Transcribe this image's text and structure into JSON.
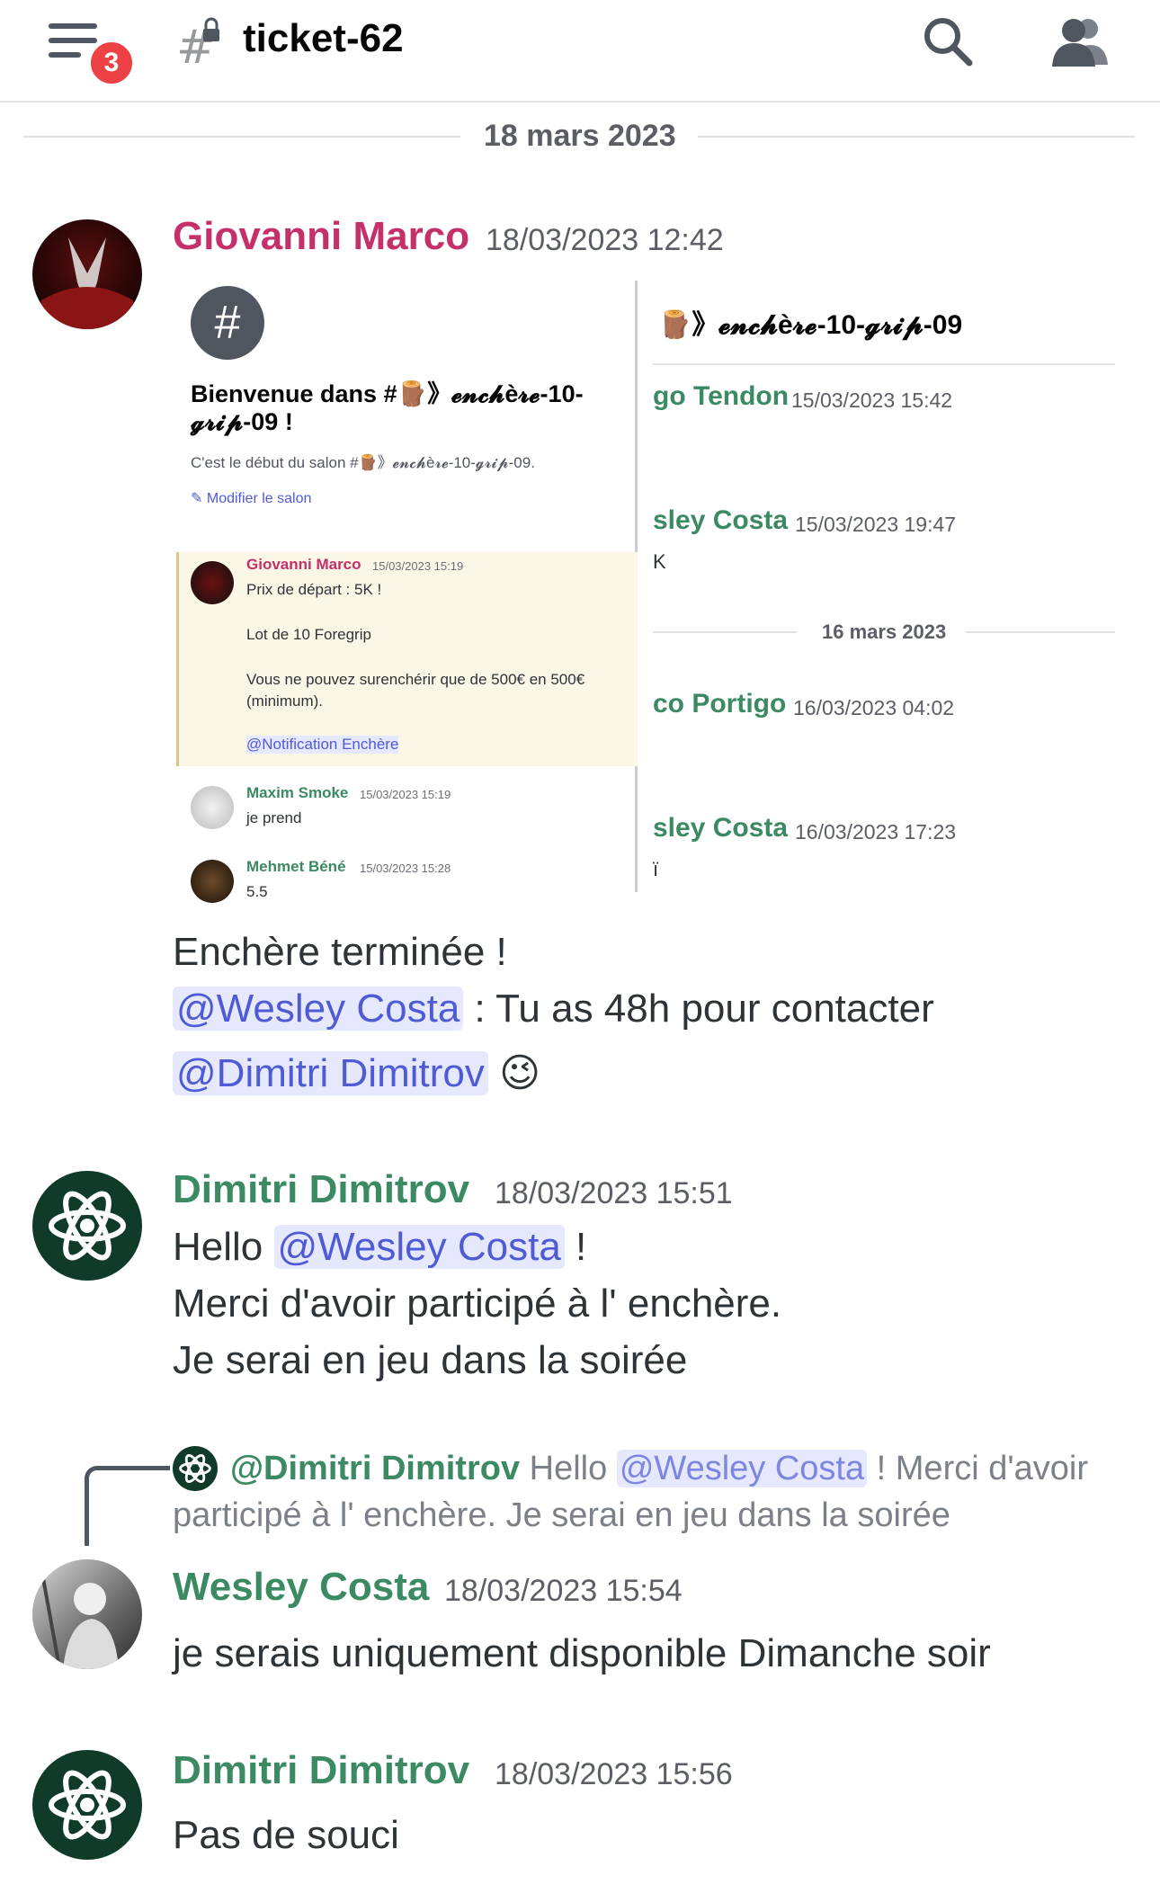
{
  "header": {
    "notification_count": "3",
    "channel_name": "ticket-62"
  },
  "date_divider": "18 mars 2023",
  "messages": [
    {
      "author": "Giovanni Marco",
      "author_color": "#c5306b",
      "timestamp": "18/03/2023 12:42",
      "lines": [
        "Enchère terminée !",
        "@Wesley Costa",
        " : Tu as 48h pour contacter",
        "@Dimitri Dimitrov",
        "😉"
      ]
    },
    {
      "author": "Dimitri Dimitrov",
      "author_color": "#3b8a63",
      "timestamp": "18/03/2023 15:51",
      "lines": [
        "Hello ",
        "@Wesley Costa",
        " !",
        "Merci d'avoir participé à l' enchère.",
        "Je serai en jeu dans la soirée"
      ]
    },
    {
      "reply": {
        "mention": "@Dimitri Dimitrov",
        "text_before": "Hello ",
        "mention2": "@Wesley Costa",
        "text_after": " ! Merci d'avoir",
        "line2": "participé à l' enchère. Je serai en jeu dans la soirée"
      },
      "author": "Wesley Costa",
      "author_color": "#3b8a63",
      "timestamp": "18/03/2023 15:54",
      "lines": [
        "je serais uniquement disponible Dimanche soir"
      ]
    },
    {
      "author": "Dimitri Dimitrov",
      "author_color": "#3b8a63",
      "timestamp": "18/03/2023 15:56",
      "lines": [
        "Pas de souci"
      ]
    }
  ],
  "attachment": {
    "left": {
      "welcome_line1": "Bienvenue dans #🪵》𝓮𝓷𝓬𝓱è𝓻𝓮-10-",
      "welcome_line2": "𝓰𝓻𝓲𝓹-09 !",
      "start_text": "C'est le début du salon #🪵》𝓮𝓷𝓬𝓱è𝓻𝓮-10-𝓰𝓻𝓲𝓹-09.",
      "edit_link": "Modifier le salon",
      "quoted": {
        "author": "Giovanni Marco",
        "ts": "15/03/2023 15:19",
        "l1": "Prix de départ : 5K !",
        "l2": "Lot de 10 Foregrip",
        "l3": "Vous ne pouvez surenchérir que de 500€ en 500€",
        "l4": "(minimum).",
        "mention": "@Notification Enchère"
      },
      "msg1": {
        "author": "Maxim Smoke",
        "ts": "15/03/2023 15:19",
        "text": "je prend"
      },
      "msg2": {
        "author": "Mehmet Béné",
        "ts": "15/03/2023 15:28",
        "text": "5.5"
      }
    },
    "right": {
      "channel": "🪵》𝓮𝓷𝓬𝓱è𝓻𝓮-10-𝓰𝓻𝓲𝓹-09",
      "rows": [
        {
          "name": "go Tendon",
          "ts": "15/03/2023 15:42"
        },
        {
          "name": "sley Costa",
          "ts": "15/03/2023 19:47",
          "extra": "K"
        },
        {
          "name": "co Portigo",
          "ts": "16/03/2023 04:02"
        },
        {
          "name": "sley Costa",
          "ts": "16/03/2023 17:23",
          "extra": "ï"
        }
      ],
      "divider": "16 mars 2023"
    }
  }
}
